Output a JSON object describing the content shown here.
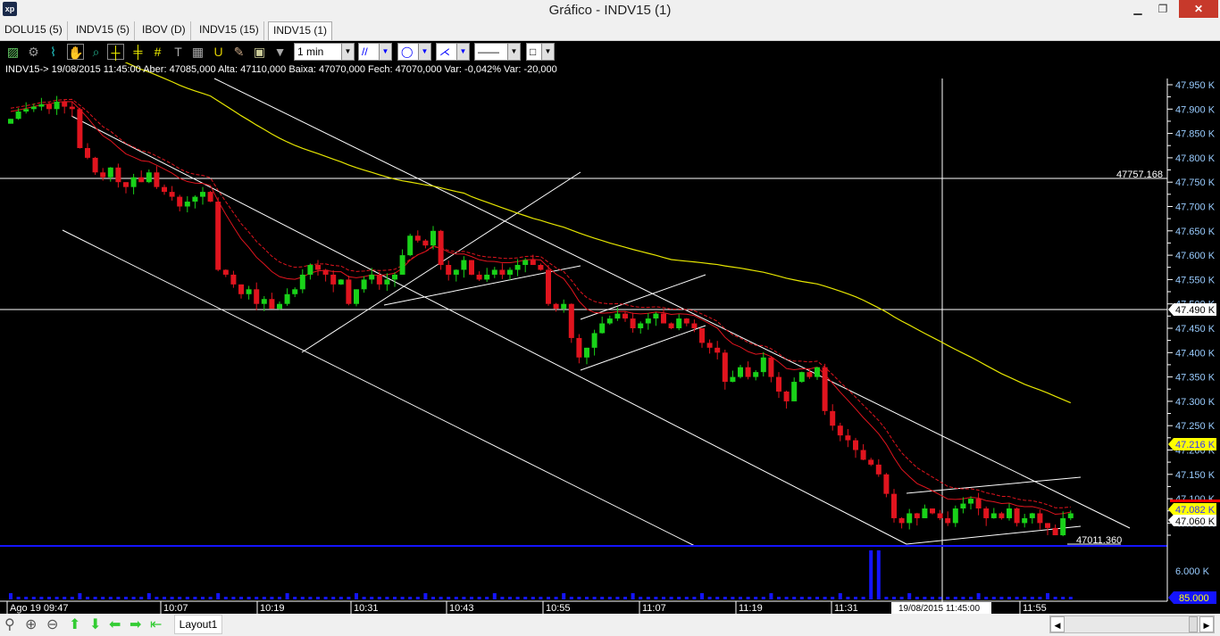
{
  "window": {
    "title": "Gráfico - INDV15 (1)",
    "logo": "xp",
    "minimize": "▁",
    "restore": "❐",
    "close": "✕"
  },
  "tabs": [
    {
      "label": "DOLU15 (5)"
    },
    {
      "label": "INDV15 (5)"
    },
    {
      "label": "IBOV (D)"
    },
    {
      "label": "INDV15 (15)"
    },
    {
      "label": "INDV15 (1)",
      "active": true
    }
  ],
  "toolbar": {
    "icons": [
      "chart-type-icon",
      "settings-icon",
      "indicator-icon",
      "hand-pan-icon",
      "zoom-region-icon",
      "crosshair-icon",
      "crosshair-arrow-icon",
      "grid-icon",
      "text-icon",
      "calculator-icon",
      "magnet-icon",
      "eraser-icon",
      "lock-icon",
      "filter-icon"
    ],
    "interval": "1 min"
  },
  "info_line": "INDV15-> 19/08/2015 11:45:00 Aber: 47085,000 Alta: 47110,000 Baixa: 47070,000 Fech: 47070,000 Var: -0,042% Var: -20,000",
  "colors": {
    "up": "#19d219",
    "down": "#e0141e",
    "ma_long": "#e6e600",
    "volume": "#1414ff",
    "line_blue": "#1414ff"
  },
  "chart_data": {
    "type": "candlestick",
    "symbol": "INDV15",
    "interval_minutes": 1,
    "start_time": "09:47",
    "closes": [
      47880,
      47895,
      47900,
      47905,
      47910,
      47900,
      47915,
      47905,
      47900,
      47820,
      47800,
      47770,
      47760,
      47780,
      47750,
      47740,
      47760,
      47750,
      47770,
      47740,
      47730,
      47720,
      47700,
      47710,
      47720,
      47730,
      47710,
      47570,
      47560,
      47540,
      47520,
      47530,
      47500,
      47510,
      47490,
      47500,
      47520,
      47530,
      47560,
      47580,
      47570,
      47560,
      47540,
      47550,
      47500,
      47530,
      47550,
      47560,
      47540,
      47550,
      47560,
      47600,
      47640,
      47630,
      47620,
      47650,
      47580,
      47560,
      47570,
      47590,
      47560,
      47550,
      47560,
      47570,
      47560,
      47570,
      47580,
      47590,
      47580,
      47570,
      47500,
      47490,
      47500,
      47430,
      47390,
      47410,
      47440,
      47460,
      47470,
      47480,
      47470,
      47450,
      47460,
      47470,
      47480,
      47460,
      47450,
      47470,
      47460,
      47450,
      47420,
      47410,
      47400,
      47340,
      47350,
      47370,
      47350,
      47360,
      47390,
      47350,
      47320,
      47300,
      47340,
      47360,
      47350,
      47370,
      47280,
      47250,
      47230,
      47220,
      47200,
      47180,
      47170,
      47150,
      47110,
      47060,
      47050,
      47070,
      47060,
      47080,
      47070,
      47060,
      47050,
      47080,
      47090,
      47100,
      47080,
      47060,
      47070,
      47060,
      47080,
      47050,
      47060,
      47070,
      47050,
      47040,
      47025,
      47060,
      47070
    ],
    "volume_spikes": [
      {
        "index": 112,
        "value": 6500
      },
      {
        "index": 113,
        "value": 6500
      }
    ],
    "price_axis": {
      "min": 47000,
      "max": 47950,
      "step": 50,
      "labels": [
        "47.950 K",
        "47.900 K",
        "47.850 K",
        "47.800 K",
        "47.750 K",
        "47.700 K",
        "47.650 K",
        "47.600 K",
        "47.550 K",
        "47.500 K",
        "47.450 K",
        "47.400 K",
        "47.350 K",
        "47.300 K",
        "47.250 K",
        "47.200 K",
        "47.150 K",
        "47.100 K",
        "47.050 K"
      ]
    },
    "volume_axis": {
      "labels": [
        "6.000 K"
      ],
      "current": "85.000"
    },
    "time_labels": [
      "Ago 19 09:47",
      "10:07",
      "10:19",
      "10:31",
      "10:43",
      "10:55",
      "11:07",
      "11:19",
      "11:31",
      "11:55"
    ],
    "crosshair": {
      "time": "19/08/2015 11:45:00",
      "price_label": "47.490 K",
      "price": 47490
    },
    "markers": {
      "horizontal_line": "47757.168",
      "horizontal_value": 47757.168,
      "low_line": "47011.360",
      "low_value": 47011.36,
      "ma_long_label": "47.216 K",
      "ma_short_label": "47.082 K",
      "last_price_label": "47.060 K"
    }
  },
  "bottom": {
    "layout_tab": "Layout1",
    "scroll_left": "◀",
    "scroll_right": "▶"
  }
}
